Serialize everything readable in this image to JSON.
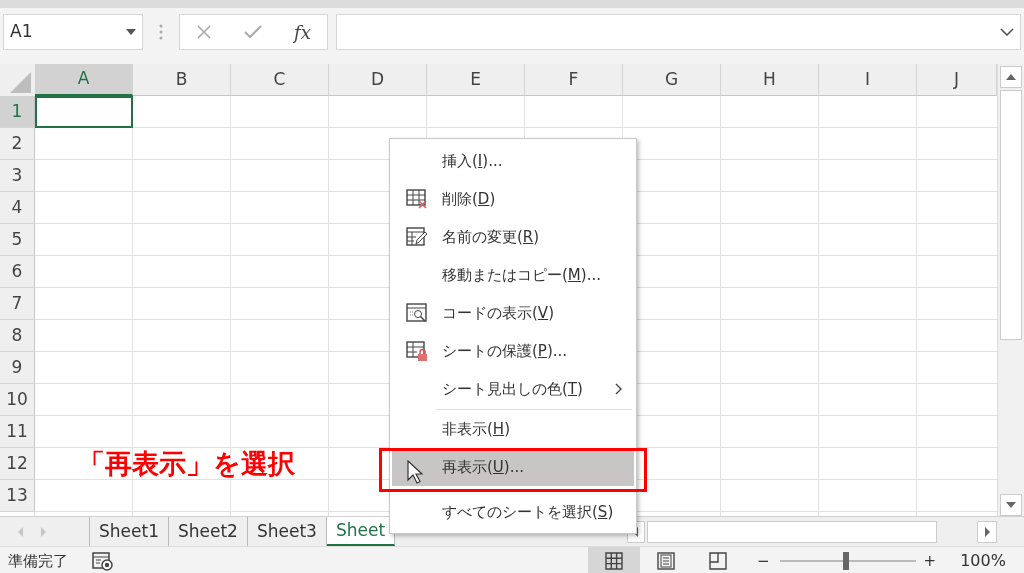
{
  "formula_bar": {
    "name_box": "A1",
    "function_button": "fx"
  },
  "columns": [
    {
      "label": "A",
      "selected": true
    },
    {
      "label": "B",
      "selected": false
    },
    {
      "label": "C",
      "selected": false
    },
    {
      "label": "D",
      "selected": false
    },
    {
      "label": "E",
      "selected": false
    },
    {
      "label": "F",
      "selected": false
    },
    {
      "label": "G",
      "selected": false
    },
    {
      "label": "H",
      "selected": false
    },
    {
      "label": "I",
      "selected": false
    },
    {
      "label": "J",
      "selected": false
    }
  ],
  "rows": [
    {
      "label": "1",
      "selected": true
    },
    {
      "label": "2",
      "selected": false
    },
    {
      "label": "3",
      "selected": false
    },
    {
      "label": "4",
      "selected": false
    },
    {
      "label": "5",
      "selected": false
    },
    {
      "label": "6",
      "selected": false
    },
    {
      "label": "7",
      "selected": false
    },
    {
      "label": "8",
      "selected": false
    },
    {
      "label": "9",
      "selected": false
    },
    {
      "label": "10",
      "selected": false
    },
    {
      "label": "11",
      "selected": false
    },
    {
      "label": "12",
      "selected": false
    },
    {
      "label": "13",
      "selected": false
    }
  ],
  "context_menu": [
    {
      "kind": "item",
      "text": "挿入(",
      "key": "I",
      "after": ")...",
      "submenu": false,
      "selected": false
    },
    {
      "kind": "item",
      "text": "削除(",
      "key": "D",
      "after": ")",
      "submenu": false,
      "selected": false
    },
    {
      "kind": "item",
      "text": "名前の変更(",
      "key": "R",
      "after": ")",
      "submenu": false,
      "selected": false
    },
    {
      "kind": "item",
      "text": "移動またはコピー(",
      "key": "M",
      "after": ")...",
      "submenu": false,
      "selected": false
    },
    {
      "kind": "item",
      "text": "コードの表示(",
      "key": "V",
      "after": ")",
      "submenu": false,
      "selected": false
    },
    {
      "kind": "item",
      "text": "シートの保護(",
      "key": "P",
      "after": ")...",
      "submenu": false,
      "selected": false
    },
    {
      "kind": "item",
      "text": "シート見出しの色(",
      "key": "T",
      "after": ")",
      "submenu": true,
      "selected": false
    },
    {
      "kind": "separator"
    },
    {
      "kind": "item",
      "text": "非表示(",
      "key": "H",
      "after": ")",
      "submenu": false,
      "selected": false
    },
    {
      "kind": "item",
      "text": "再表示(",
      "key": "U",
      "after": ")...",
      "submenu": false,
      "selected": true
    },
    {
      "kind": "item",
      "text": "すべてのシートを選択(",
      "key": "S",
      "after": ")",
      "submenu": false,
      "selected": false
    }
  ],
  "annotation": {
    "text": "「再表示」を選択",
    "color": "#ff0000"
  },
  "sheet_tabs": [
    {
      "label": "Sheet1",
      "selected": false
    },
    {
      "label": "Sheet2",
      "selected": false
    },
    {
      "label": "Sheet3",
      "selected": false
    },
    {
      "label": "Sheet",
      "selected": true
    }
  ],
  "status_bar": {
    "status": "準備完了",
    "views": [
      {
        "kind": "normal",
        "selected": true
      },
      {
        "kind": "page_layout",
        "selected": false
      },
      {
        "kind": "page_break",
        "selected": false
      }
    ],
    "zoom": {
      "minus": "−",
      "plus": "+",
      "level": 0.49,
      "reading": "100%"
    }
  }
}
